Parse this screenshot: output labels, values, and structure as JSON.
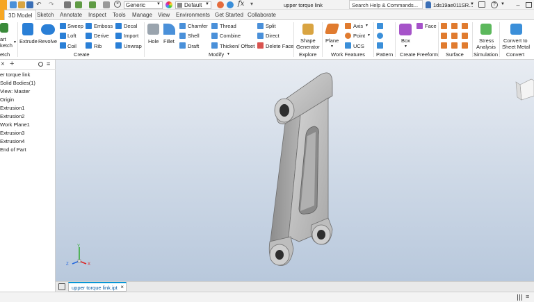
{
  "app": {
    "document_title": "upper torque link"
  },
  "qat": {
    "appearance": "Generic",
    "material": "Default",
    "search_placeholder": "Search Help & Commands...",
    "user": "1ds19ae011SR..."
  },
  "tabs": [
    "3D Model",
    "Sketch",
    "Annotate",
    "Inspect",
    "Tools",
    "Manage",
    "View",
    "Environments",
    "Get Started",
    "Collaborate"
  ],
  "ribbon": {
    "sketch": {
      "start_line1": "art",
      "start_line2": "ketch",
      "group_label": "etch"
    },
    "create": {
      "group": "Create",
      "extrude": "Extrude",
      "revolve": "Revolve",
      "sweep": "Sweep",
      "loft": "Loft",
      "coil": "Coil",
      "emboss": "Emboss",
      "derive": "Derive",
      "rib": "Rib",
      "decal": "Decal",
      "import": "Import",
      "unwrap": "Unwrap"
    },
    "modify": {
      "group": "Modify",
      "hole": "Hole",
      "fillet": "Fillet",
      "chamfer": "Chamfer",
      "shell": "Shell",
      "draft": "Draft",
      "thread": "Thread",
      "combine": "Combine",
      "thicken": "Thicken/ Offset",
      "split": "Split",
      "direct": "Direct",
      "delete_face": "Delete Face"
    },
    "explore": {
      "group": "Explore",
      "shape_line1": "Shape",
      "shape_line2": "Generator"
    },
    "work": {
      "group": "Work Features",
      "plane": "Plane",
      "axis": "Axis",
      "point": "Point",
      "ucs": "UCS"
    },
    "pattern": {
      "group": "Pattern"
    },
    "freeform": {
      "group": "Create Freeform",
      "box": "Box",
      "face": "Face"
    },
    "surface": {
      "group": "Surface"
    },
    "simulation": {
      "group": "Simulation",
      "stress_line1": "Stress",
      "stress_line2": "Analysis"
    },
    "convert": {
      "group": "Convert",
      "sheet_line1": "Convert to",
      "sheet_line2": "Sheet Metal"
    }
  },
  "browser": {
    "items": [
      "er torque link",
      "Solid Bodies(1)",
      "View: Master",
      "Origin",
      "Extrusion1",
      "Extrusion2",
      "Work Plane1",
      "Extrusion3",
      "Extrusion4",
      "End of Part"
    ]
  },
  "viewport": {
    "axis_x": "X",
    "axis_y": "Y",
    "axis_z": "Z"
  },
  "doc_tab": {
    "label": "upper torque link.ipt"
  },
  "colors": {
    "accent": "#0696d7",
    "active_tab_border": "#f6a623",
    "create_icon": "#2a7fd6",
    "modify_icon": "#4a90d9",
    "freeform_icon": "#a653c9",
    "surface_icon": "#e07b2f",
    "viewport_top": "#e8ecf2",
    "viewport_bottom": "#b8c8dc"
  }
}
